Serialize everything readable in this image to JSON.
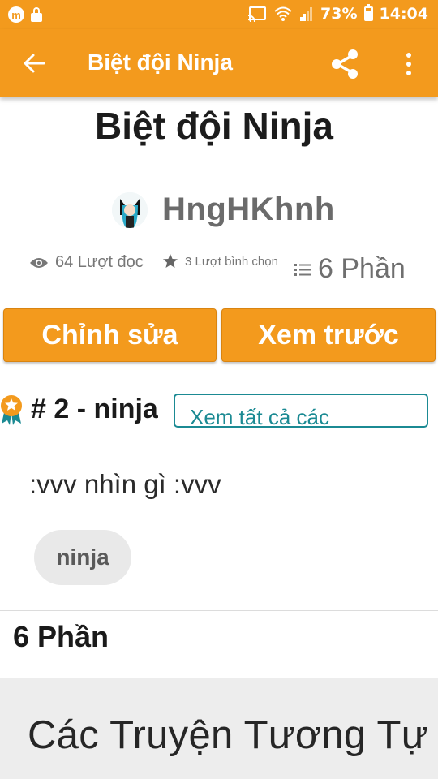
{
  "status_bar": {
    "app_badge": "m",
    "battery": "73%",
    "time": "14:04",
    "battery_level": 0.73
  },
  "app_bar": {
    "title": "Biệt đội Ninja"
  },
  "story": {
    "title": "Biệt đội Ninja",
    "author": "HngHKhnh",
    "reads": "64 Lượt đọc",
    "votes": "3 Lượt bình chọn",
    "parts": "6 Phần"
  },
  "actions": {
    "edit_label": "Chỉnh sửa",
    "preview_label": "Xem trước"
  },
  "ranking": {
    "label": "# 2 - ninja",
    "see_all_label": "Xem tất cả các"
  },
  "description": ":vvv nhìn gì :vvv",
  "tags": [
    "ninja"
  ],
  "parts_heading": "6 Phần",
  "similar_heading": "Các Truyện Tương Tự",
  "colors": {
    "accent": "#f39a1d",
    "link": "#1b8a93"
  }
}
